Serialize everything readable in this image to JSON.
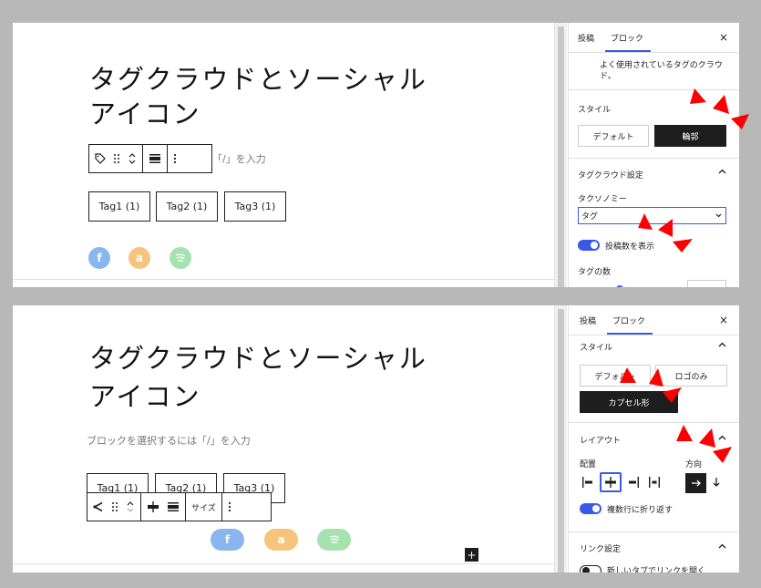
{
  "top": {
    "title_lines": [
      "タグクラウドとソーシャル",
      "アイコン"
    ],
    "placeholder": "「/」を入力",
    "tags": [
      "Tag1 (1)",
      "Tag2 (1)",
      "Tag3 (1)"
    ],
    "sidebar": {
      "tabs": [
        "投稿",
        "ブロック"
      ],
      "close": "×",
      "description": "よく使用されているタグのクラウ",
      "description2": "ド。",
      "style_heading": "スタイル",
      "style_default": "デフォルト",
      "style_outline": "輪郭",
      "tagcloud_heading": "タグクラウド設定",
      "taxonomy_label": "タクソノミー",
      "taxonomy_value": "タグ",
      "show_count_label": "投稿数を表示",
      "tag_count_label": "タグの数"
    }
  },
  "bottom": {
    "title_lines": [
      "タグクラウドとソーシャル",
      "アイコン"
    ],
    "placeholder": "ブロックを選択するには「/」を入力",
    "tags": [
      "Tag1 (1)",
      "Tag2 (1)",
      "Tag3 (1)"
    ],
    "toolbar_size": "サイズ",
    "add_button": "+",
    "sidebar": {
      "tabs": [
        "投稿",
        "ブロック"
      ],
      "close": "×",
      "style_heading": "スタイル",
      "style_default": "デフォルト",
      "style_logo_only": "ロゴのみ",
      "style_pill": "カプセル形",
      "layout_heading": "レイアウト",
      "justification_label": "配置",
      "orientation_label": "方向",
      "wrap_label": "複数行に折り返す",
      "link_heading": "リンク設定",
      "link_newtab_label": "新しいタブでリンクを開く"
    }
  },
  "colors": {
    "accent": "#3858e9",
    "arrow": "#ff0000"
  }
}
